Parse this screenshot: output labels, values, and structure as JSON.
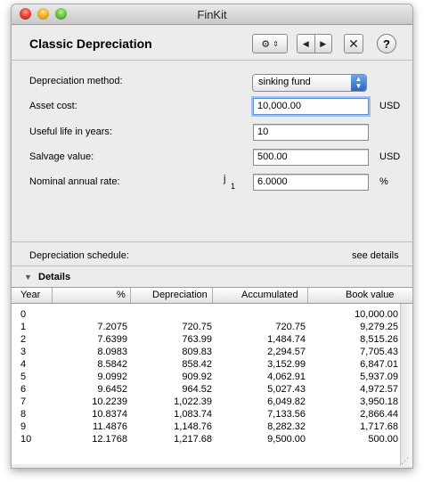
{
  "window": {
    "title": "FinKit"
  },
  "header": {
    "title": "Classic Depreciation"
  },
  "toolbar": {
    "action_icon": "gear-icon",
    "back_icon": "left-arrow-icon",
    "forward_icon": "right-arrow-icon",
    "close_icon": "close-icon",
    "help_label": "?"
  },
  "form": {
    "method_label": "Depreciation method:",
    "method_value": "sinking fund",
    "cost_label": "Asset cost:",
    "cost_value": "10,000.00",
    "cost_unit": "USD",
    "life_label": "Useful life in years:",
    "life_value": "10",
    "salvage_label": "Salvage value:",
    "salvage_value": "500.00",
    "salvage_unit": "USD",
    "rate_label": "Nominal annual rate:",
    "rate_symbol": "j",
    "rate_subscript": "1",
    "rate_value": "6.0000",
    "rate_unit": "%"
  },
  "schedule": {
    "label": "Depreciation schedule:",
    "link": "see details"
  },
  "details": {
    "label": "Details"
  },
  "table": {
    "headers": [
      "Year",
      "%",
      "Depreciation",
      "Accumulated",
      "Book value"
    ],
    "rows": [
      [
        "0",
        "",
        "",
        "",
        "10,000.00"
      ],
      [
        "1",
        "7.2075",
        "720.75",
        "720.75",
        "9,279.25"
      ],
      [
        "2",
        "7.6399",
        "763.99",
        "1,484.74",
        "8,515.26"
      ],
      [
        "3",
        "8.0983",
        "809.83",
        "2,294.57",
        "7,705.43"
      ],
      [
        "4",
        "8.5842",
        "858.42",
        "3,152.99",
        "6,847.01"
      ],
      [
        "5",
        "9.0992",
        "909.92",
        "4,062.91",
        "5,937.09"
      ],
      [
        "6",
        "9.6452",
        "964.52",
        "5,027.43",
        "4,972.57"
      ],
      [
        "7",
        "10.2239",
        "1,022.39",
        "6,049.82",
        "3,950.18"
      ],
      [
        "8",
        "10.8374",
        "1,083.74",
        "7,133.56",
        "2,866.44"
      ],
      [
        "9",
        "11.4876",
        "1,148.76",
        "8,282.32",
        "1,717.68"
      ],
      [
        "10",
        "12.1768",
        "1,217.68",
        "9,500.00",
        "500.00"
      ]
    ]
  }
}
